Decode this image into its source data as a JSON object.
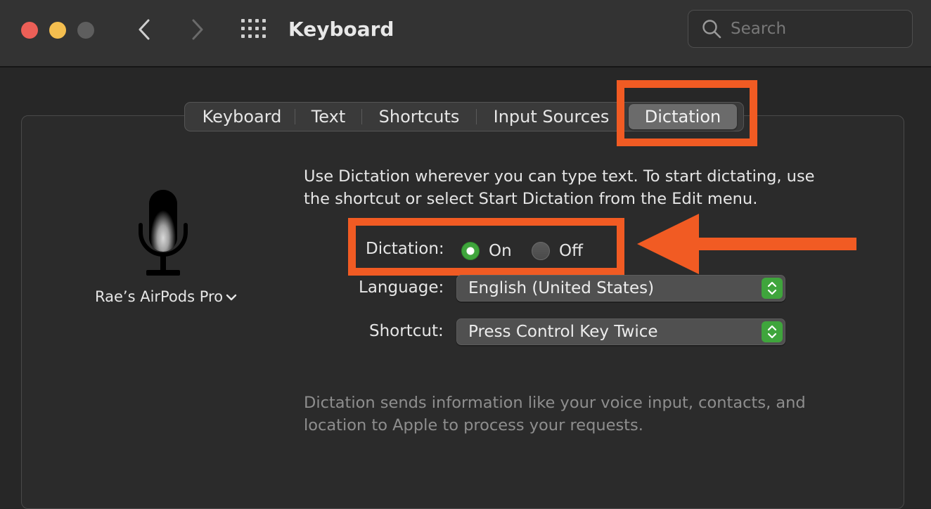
{
  "window": {
    "title": "Keyboard",
    "search_placeholder": "Search"
  },
  "tabs": [
    {
      "label": "Keyboard",
      "selected": false
    },
    {
      "label": "Text",
      "selected": false
    },
    {
      "label": "Shortcuts",
      "selected": false
    },
    {
      "label": "Input Sources",
      "selected": false
    },
    {
      "label": "Dictation",
      "selected": true
    }
  ],
  "dictation": {
    "description": "Use Dictation wherever you can type text. To start dictating, use the shortcut or select Start Dictation from the Edit menu.",
    "device": "Rae’s AirPods Pro",
    "toggle_label": "Dictation:",
    "on_label": "On",
    "off_label": "Off",
    "state": "on",
    "language_label": "Language:",
    "language_value": "English (United States)",
    "shortcut_label": "Shortcut:",
    "shortcut_value": "Press Control Key Twice",
    "privacy_note": "Dictation sends information like your voice input, contacts, and location to Apple to process your requests."
  },
  "colors": {
    "annotation": "#f15b23",
    "accent_green": "#3fa53c",
    "close": "#ec5f57",
    "minimize": "#f4be4f"
  }
}
